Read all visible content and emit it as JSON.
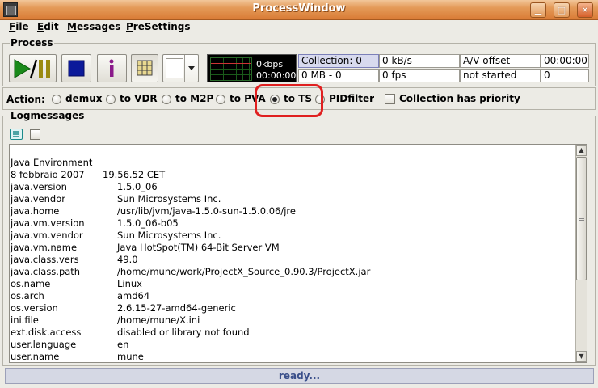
{
  "window": {
    "title": "ProcessWindow"
  },
  "menu": [
    "File",
    "Edit",
    "Messages",
    "PreSettings"
  ],
  "process": {
    "label": "Process",
    "monitor": {
      "rate": "0kbps",
      "time": "00:00:00"
    },
    "stats": {
      "collection": "Collection: 0",
      "kbs": "0 kB/s",
      "av_offset_label": "A/V offset",
      "av_offset_value": "00:00:00",
      "mb": "0 MB - 0",
      "fps": "0 fps",
      "state": "not started",
      "count": "0"
    }
  },
  "action": {
    "label": "Action:",
    "options": [
      "demux",
      "to VDR",
      "to M2P",
      "to PVA",
      "to TS",
      "PIDfilter"
    ],
    "selected": "to TS",
    "priority_label": "Collection has priority"
  },
  "logs": {
    "label": "Logmessages",
    "header": "Java Environment",
    "date": "8 febbraio 2007",
    "time": "19.56.52 CET",
    "entries": [
      {
        "key": "java.version",
        "value": "1.5.0_06"
      },
      {
        "key": "java.vendor",
        "value": "Sun Microsystems Inc."
      },
      {
        "key": "java.home",
        "value": "/usr/lib/jvm/java-1.5.0-sun-1.5.0.06/jre"
      },
      {
        "key": "java.vm.version",
        "value": "1.5.0_06-b05"
      },
      {
        "key": "java.vm.vendor",
        "value": "Sun Microsystems Inc."
      },
      {
        "key": "java.vm.name",
        "value": "Java HotSpot(TM) 64-Bit Server VM"
      },
      {
        "key": "java.class.vers",
        "value": "49.0"
      },
      {
        "key": "java.class.path",
        "value": "/home/mune/work/ProjectX_Source_0.90.3/ProjectX.jar"
      },
      {
        "key": "os.name",
        "value": "Linux"
      },
      {
        "key": "os.arch",
        "value": "amd64"
      },
      {
        "key": "os.version",
        "value": "2.6.15-27-amd64-generic"
      },
      {
        "key": "ini.file",
        "value": "/home/mune/X.ini"
      },
      {
        "key": "ext.disk.access",
        "value": "disabled or library not found"
      },
      {
        "key": "user.language",
        "value": "en"
      },
      {
        "key": "user.name",
        "value": "mune"
      }
    ]
  },
  "status": "ready...",
  "colors": {
    "titlebar": "#E49A58",
    "highlight": "#E02020",
    "status_text": "#3A4F8A"
  }
}
